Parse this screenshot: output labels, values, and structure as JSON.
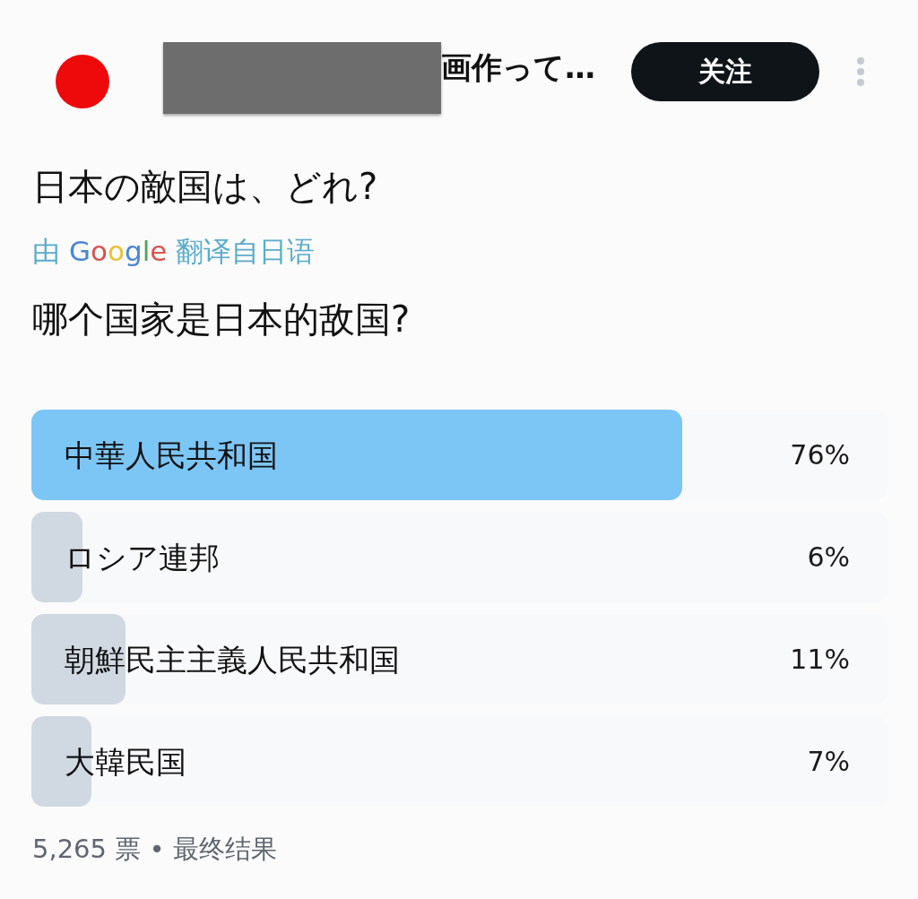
{
  "header": {
    "name": "画作って…",
    "follow_button": "关注"
  },
  "question": "日本の敵国は、どれ?",
  "translation_credit": {
    "prefix": "由",
    "brand": "Google",
    "suffix": "翻译自日语"
  },
  "translated_question": "哪个国家是日本的敌国?",
  "poll": {
    "options": [
      {
        "label": "中華人民共和国",
        "level": 0.76,
        "percent": "76%",
        "leading": true
      },
      {
        "label": "ロシア連邦",
        "level": 0.06,
        "percent": "6%",
        "leading": false
      },
      {
        "label": "朝鮮民主主義人民共和国",
        "level": 0.11,
        "percent": "11%",
        "leading": false
      },
      {
        "label": "大韓民国",
        "level": 0.07,
        "percent": "7%",
        "leading": false
      }
    ],
    "summary": "5,265 票 • 最终结果"
  }
}
